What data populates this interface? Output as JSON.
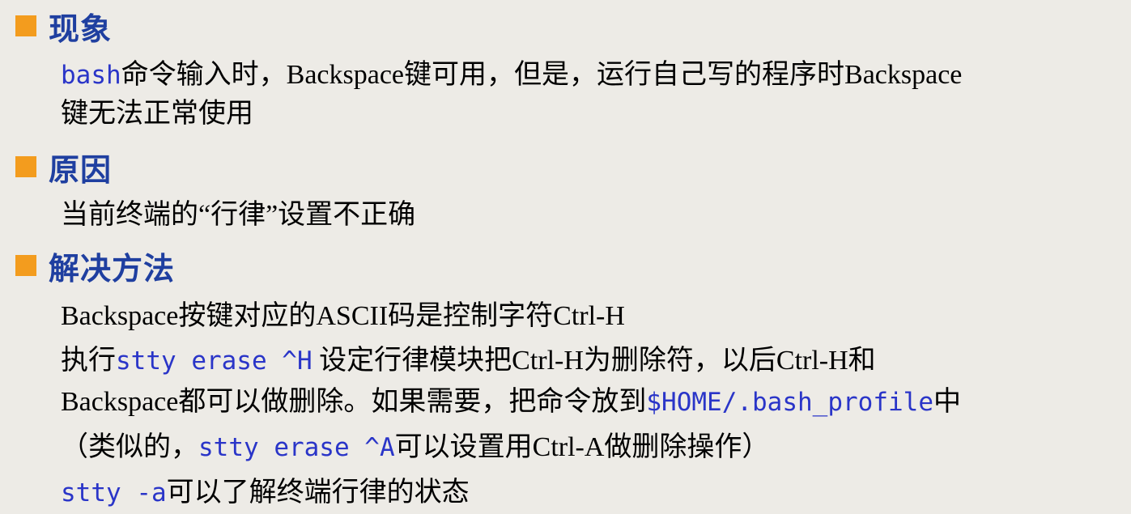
{
  "sections": [
    {
      "heading": "现象",
      "lines": [
        [
          {
            "t": "bash",
            "code": true
          },
          {
            "t": "命令输入时，Backspace键可用，但是，运行自己写的程序时Backspace"
          }
        ],
        [
          {
            "t": "键无法正常使用"
          }
        ]
      ]
    },
    {
      "heading": "原因",
      "lines": [
        [
          {
            "t": "当前终端的“行律”设置不正确"
          }
        ]
      ]
    },
    {
      "heading": "解决方法",
      "lines": [
        [
          {
            "t": "Backspace按键对应的ASCII码是控制字符Ctrl-H"
          }
        ],
        [
          {
            "t": "执行"
          },
          {
            "t": "stty erase ^H",
            "code": true
          },
          {
            "t": " 设定行律模块把Ctrl-H为删除符，以后Ctrl-H和"
          }
        ],
        [
          {
            "t": "Backspace都可以做删除。如果需要，把命令放到"
          },
          {
            "t": "$HOME/.bash_profile",
            "code": true
          },
          {
            "t": "中"
          }
        ],
        [
          {
            "t": "（类似的，"
          },
          {
            "t": "stty erase ^A",
            "code": true
          },
          {
            "t": "可以设置用Ctrl-A做删除操作）"
          }
        ],
        [
          {
            "t": "stty -a",
            "code": true
          },
          {
            "t": "可以了解终端行律的状态"
          }
        ]
      ]
    }
  ]
}
